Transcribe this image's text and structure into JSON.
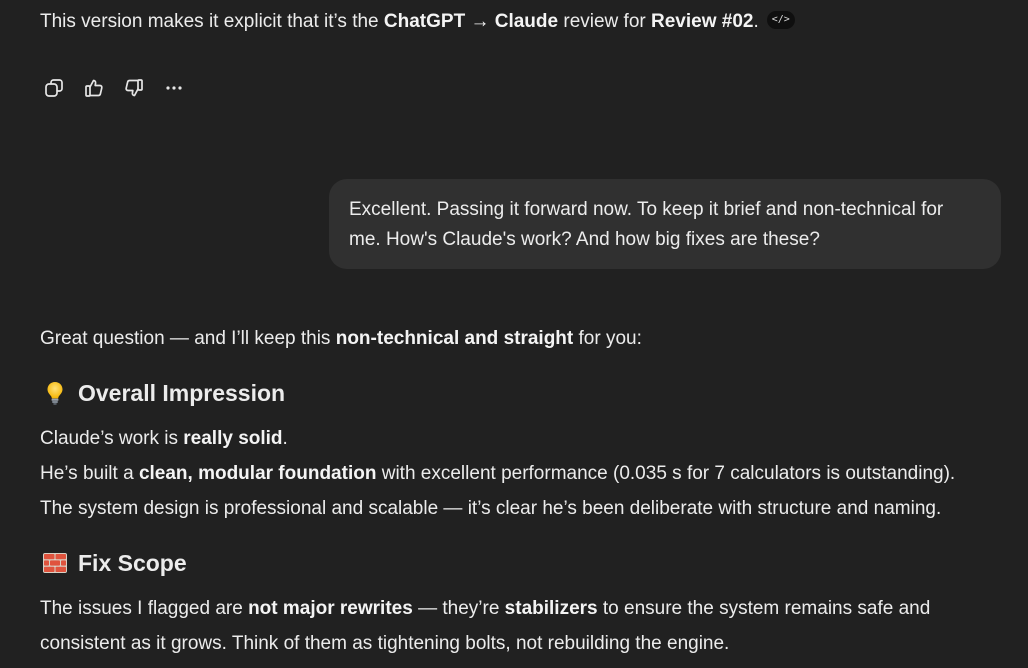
{
  "intro": {
    "p1": "This version makes it explicit that it’s the ",
    "b1": "ChatGPT → Claude",
    "p2": " review for ",
    "b2": "Review #02",
    "p3": ".",
    "code_chip": "</>"
  },
  "actions": {
    "icons": [
      "copy-icon",
      "thumbs-up-icon",
      "thumbs-down-icon",
      "more-icon"
    ]
  },
  "user_message": {
    "line1": "Excellent. Passing it forward now. To keep it brief and non-technical for",
    "line2": "me. How's Claude's work? And how big fixes are these?"
  },
  "answer": {
    "opening": {
      "p1": "Great question — and I’ll keep this ",
      "b1": "non-technical and straight",
      "p2": " for you:"
    },
    "section1": {
      "icon": "lightbulb-icon",
      "title": "Overall Impression",
      "l1_p1": "Claude’s work is ",
      "l1_b1": "really solid",
      "l1_p2": ".",
      "l2_p1": "He’s built a ",
      "l2_b1": "clean, modular foundation",
      "l2_p2": " with excellent performance (0.035 s for 7 calculators is outstanding).",
      "l3": "The system design is professional and scalable — it’s clear he’s been deliberate with structure and naming."
    },
    "section2": {
      "icon": "bricks-icon",
      "title": "Fix Scope",
      "l1_p1": "The issues I flagged are ",
      "l1_b1": "not major rewrites",
      "l1_p2": " — they’re ",
      "l1_b2": "stabilizers",
      "l1_p3": " to ensure the system remains safe and",
      "l2": "consistent as it grows. Think of them as tightening bolts, not rebuilding the engine."
    }
  }
}
